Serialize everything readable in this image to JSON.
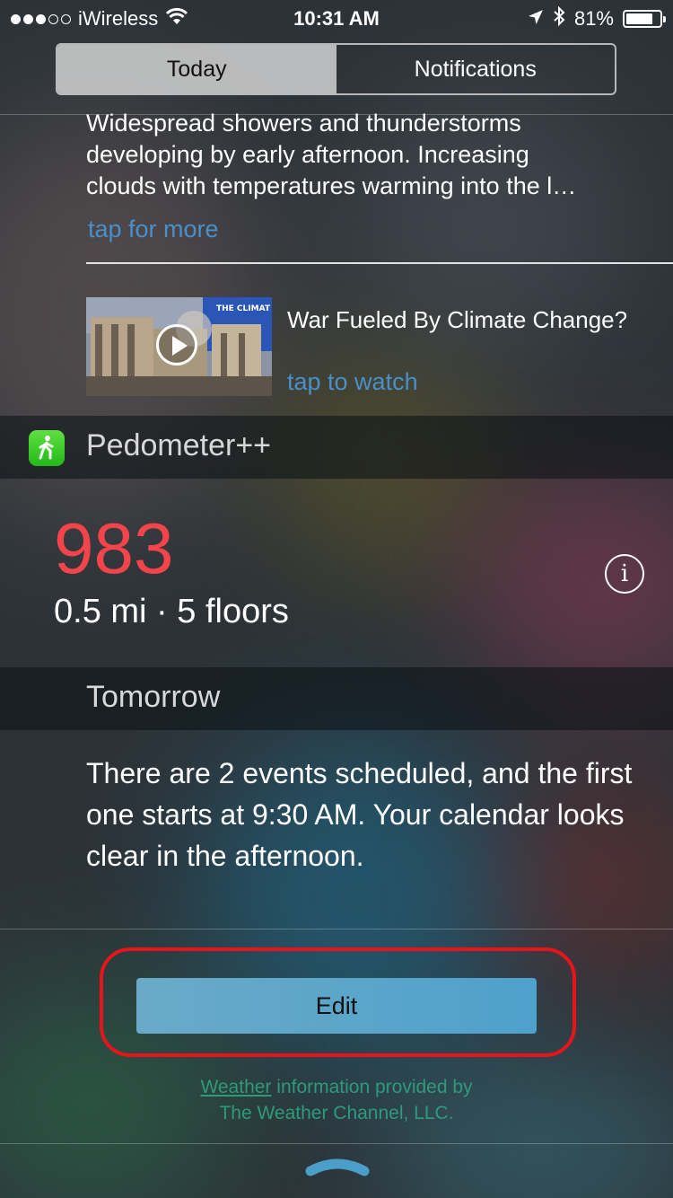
{
  "status_bar": {
    "signal_filled": 3,
    "signal_total": 5,
    "carrier": "iWireless",
    "time": "10:31 AM",
    "battery_percent": "81%",
    "battery_level": 0.81
  },
  "tabs": [
    {
      "label": "Today",
      "active": true
    },
    {
      "label": "Notifications",
      "active": false
    }
  ],
  "weather": {
    "lines": [
      "Widespread showers and thunderstorms",
      "developing by early afternoon. Increasing",
      "clouds with temperatures warming into the l…"
    ],
    "tap_more": "tap for more",
    "video_title": "War Fueled By Climate Change?",
    "video_thumb_text": "THE CLIMAT",
    "tap_watch": "tap to watch"
  },
  "pedometer": {
    "app_name": "Pedometer++",
    "steps": "983",
    "distance": "0.5 mi · 5 floors"
  },
  "tomorrow": {
    "title": "Tomorrow",
    "summary": "There are 2 events scheduled, and the first one starts at 9:30 AM. Your calendar looks clear in the afternoon."
  },
  "edit_label": "Edit",
  "credit": {
    "link": "Weather",
    "rest_line1": " information provided by",
    "line2": "The Weather Channel, LLC."
  },
  "colors": {
    "accent_blue": "#4a8fc8",
    "steps_red": "#f2444a",
    "highlight_red": "#e8141c",
    "credit_green": "#2f9a7a"
  }
}
